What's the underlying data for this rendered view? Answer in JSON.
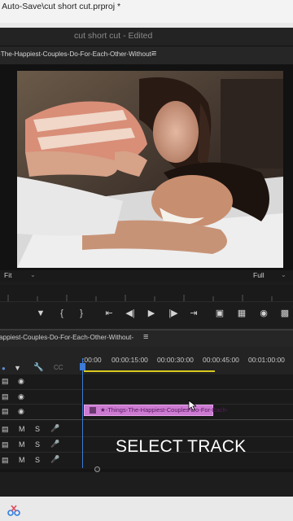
{
  "window": {
    "title": "o Auto-Save\\cut short cut.prproj *"
  },
  "project_header": {
    "title": "cut short cut - Edited"
  },
  "program_monitor": {
    "tab_title": "-The-Happiest-Couples-Do-For-Each-Other-Without-",
    "menu_icon": "≡",
    "fit_label": "Fit",
    "full_label": "Full"
  },
  "transport": {
    "icons": [
      "marker-icon",
      "mark-in-icon",
      "mark-out-icon",
      "go-to-in-icon",
      "step-back-icon",
      "play-icon",
      "step-forward-icon",
      "go-to-out-icon",
      "insert-icon",
      "overwrite-icon",
      "export-frame-icon",
      "compare-icon"
    ]
  },
  "sequence": {
    "tab_title": "appiest-Couples-Do-For-Each-Other-Without-",
    "menu_icon": "≡",
    "timecodes": [
      ":00:00",
      "00:00:15:00",
      "00:00:30:00",
      "00:00:45:00",
      "00:01:00:00"
    ],
    "clip_label": "★-Things-The-Happiest-Couples-Do-For-Each-",
    "audio_labels": {
      "mute": "M",
      "solo": "S"
    }
  },
  "overlay": {
    "caption": "SELECT TRACK"
  },
  "colors": {
    "clip": "#cc7ad2",
    "playhead": "#3d7bd8",
    "work_area": "#d8c81e"
  }
}
